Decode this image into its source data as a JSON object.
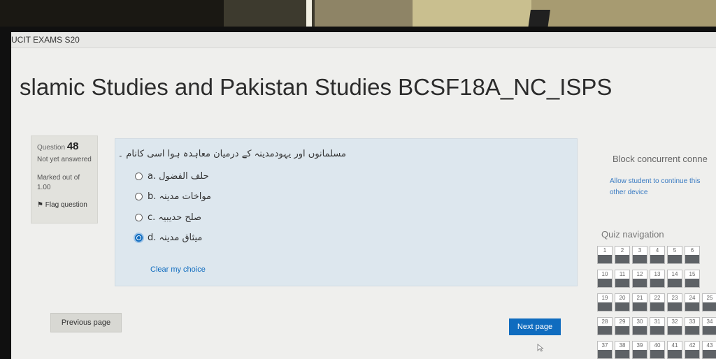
{
  "site": {
    "name": "UCIT EXAMS S20"
  },
  "page": {
    "title": "slamic Studies and Pakistan Studies BCSF18A_NC_ISPS"
  },
  "question_info": {
    "label": "Question",
    "number": "48",
    "state": "Not yet answered",
    "marks": "Marked out of 1.00",
    "flag": "Flag question"
  },
  "question": {
    "text": "مسلمانوں اور یہودمدینہ کے درمیان معاہدہ ہوا اسی کانام ۔",
    "answers": [
      {
        "letter": "a.",
        "text": "حلف الفضول",
        "selected": false
      },
      {
        "letter": "b.",
        "text": "مواخات مدینہ",
        "selected": false
      },
      {
        "letter": "c.",
        "text": "صلح حدیبیہ",
        "selected": false
      },
      {
        "letter": "d.",
        "text": "میثاق مدینہ",
        "selected": true
      }
    ],
    "clear": "Clear my choice"
  },
  "nav_buttons": {
    "previous": "Previous page",
    "next": "Next page"
  },
  "block": {
    "title": "Block concurrent conne",
    "link_line1": "Allow student to continue this",
    "link_line2": "other device"
  },
  "quiz_nav": {
    "title": "Quiz navigation",
    "rows": [
      [
        "1",
        "2",
        "3",
        "4",
        "5",
        "6"
      ],
      [
        "10",
        "11",
        "12",
        "13",
        "14",
        "15"
      ],
      [
        "19",
        "20",
        "21",
        "22",
        "23",
        "24",
        "25"
      ],
      [
        "28",
        "29",
        "30",
        "31",
        "32",
        "33",
        "34"
      ],
      [
        "37",
        "38",
        "39",
        "40",
        "41",
        "42",
        "43"
      ]
    ]
  }
}
